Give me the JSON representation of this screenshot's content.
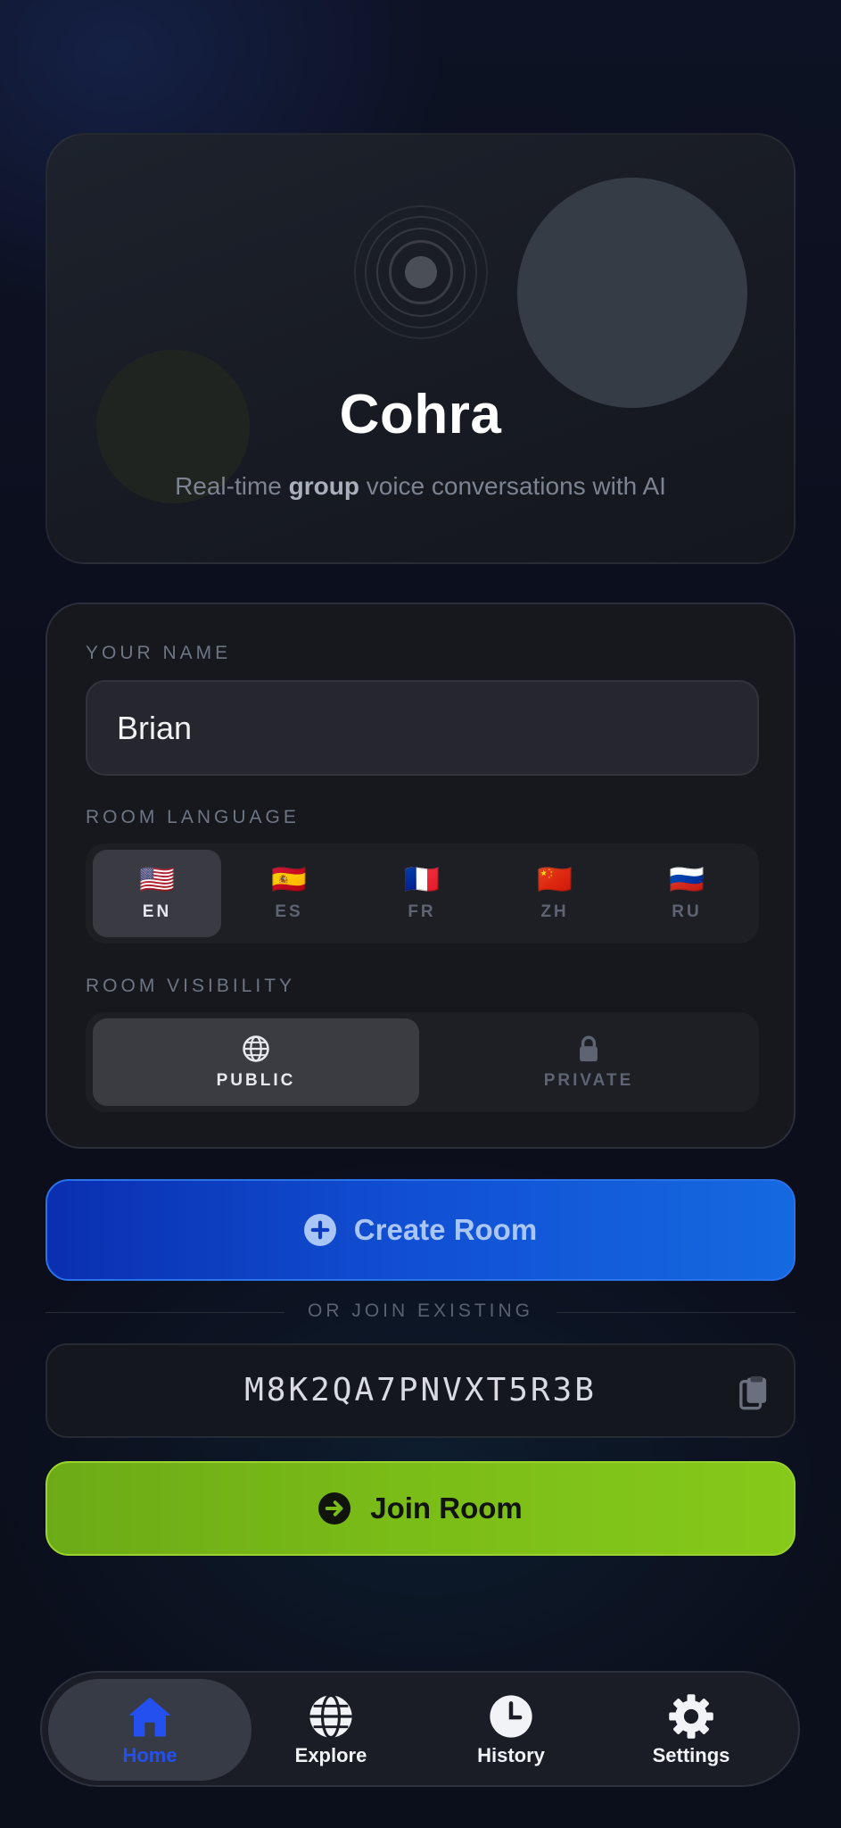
{
  "hero": {
    "title": "Cohra",
    "subtitle_before": "Real-time ",
    "subtitle_bold": "group",
    "subtitle_after": " voice conversations with AI"
  },
  "form": {
    "name_label": "YOUR NAME",
    "name_value": "Brian",
    "language_label": "ROOM LANGUAGE",
    "languages": [
      {
        "code": "EN",
        "flag": "🇺🇸",
        "selected": true
      },
      {
        "code": "ES",
        "flag": "🇪🇸",
        "selected": false
      },
      {
        "code": "FR",
        "flag": "🇫🇷",
        "selected": false
      },
      {
        "code": "ZH",
        "flag": "🇨🇳",
        "selected": false
      },
      {
        "code": "RU",
        "flag": "🇷🇺",
        "selected": false
      }
    ],
    "visibility_label": "ROOM VISIBILITY",
    "visibility": [
      {
        "label": "PUBLIC",
        "icon": "globe-icon",
        "selected": true
      },
      {
        "label": "PRIVATE",
        "icon": "lock-icon",
        "selected": false
      }
    ]
  },
  "create_button": {
    "label": "Create Room",
    "icon": "plus-circle-icon"
  },
  "divider_text": "OR JOIN EXISTING",
  "room_code": {
    "value": "M8K2QA7PNVXT5R3B",
    "icon": "paste-icon"
  },
  "join_button": {
    "label": "Join Room",
    "icon": "arrow-right-circle-icon"
  },
  "nav": {
    "items": [
      {
        "label": "Home",
        "icon": "home-icon",
        "active": true
      },
      {
        "label": "Explore",
        "icon": "globe-icon",
        "active": false
      },
      {
        "label": "History",
        "icon": "clock-icon",
        "active": false
      },
      {
        "label": "Settings",
        "icon": "gear-icon",
        "active": false
      }
    ]
  },
  "colors": {
    "accent_blue": "#1150d4",
    "accent_green": "#7bbd18",
    "active_nav": "#2550f0"
  }
}
